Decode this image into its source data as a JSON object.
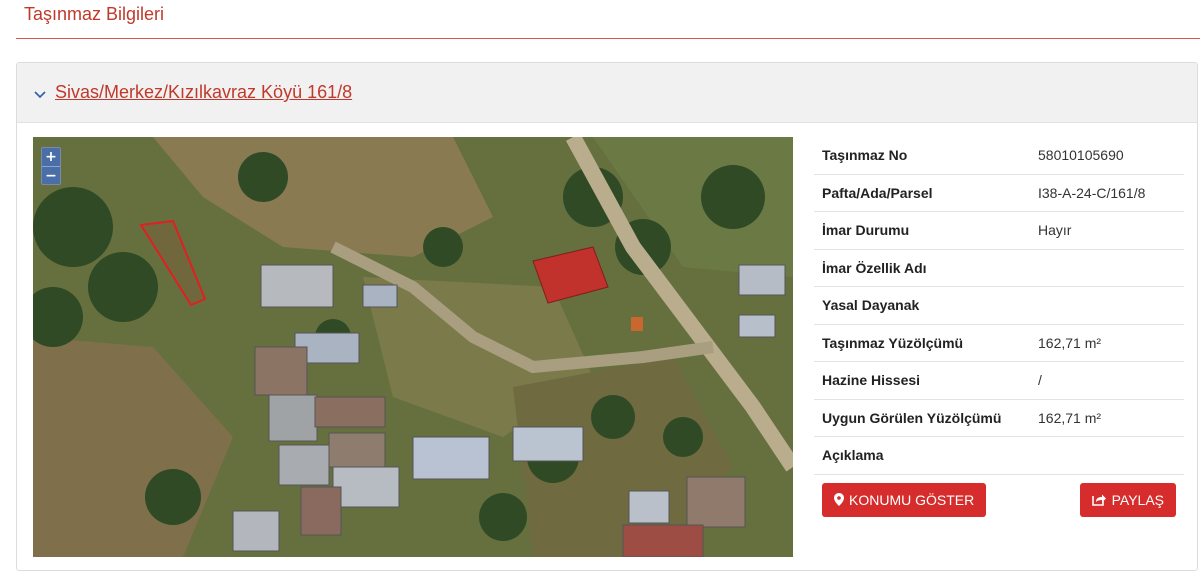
{
  "page": {
    "title": "Taşınmaz Bilgileri"
  },
  "panel": {
    "header_link": "Sivas/Merkez/Kızılkavraz Köyü 161/8"
  },
  "map": {
    "zoom_in": "+",
    "zoom_out": "−"
  },
  "info": {
    "rows": [
      {
        "label": "Taşınmaz No",
        "value": "58010105690"
      },
      {
        "label": "Pafta/Ada/Parsel",
        "value": "I38-A-24-C/161/8"
      },
      {
        "label": "İmar Durumu",
        "value": "Hayır"
      },
      {
        "label": "İmar Özellik Adı",
        "value": ""
      },
      {
        "label": "Yasal Dayanak",
        "value": ""
      },
      {
        "label": "Taşınmaz Yüzölçümü",
        "value": "162,71 m²"
      },
      {
        "label": "Hazine Hissesi",
        "value": "/"
      },
      {
        "label": "Uygun Görülen Yüzölçümü",
        "value": "162,71 m²"
      },
      {
        "label": "Açıklama",
        "value": ""
      }
    ]
  },
  "actions": {
    "show_location": "KONUMU GÖSTER",
    "share": "PAYLAŞ"
  },
  "colors": {
    "accent": "#c0392b",
    "button": "#d62c2c",
    "zoom": "#4a6fa8"
  },
  "icons": {
    "header": "chevron-down-icon",
    "show_location": "map-marker-icon",
    "share": "share-icon"
  }
}
